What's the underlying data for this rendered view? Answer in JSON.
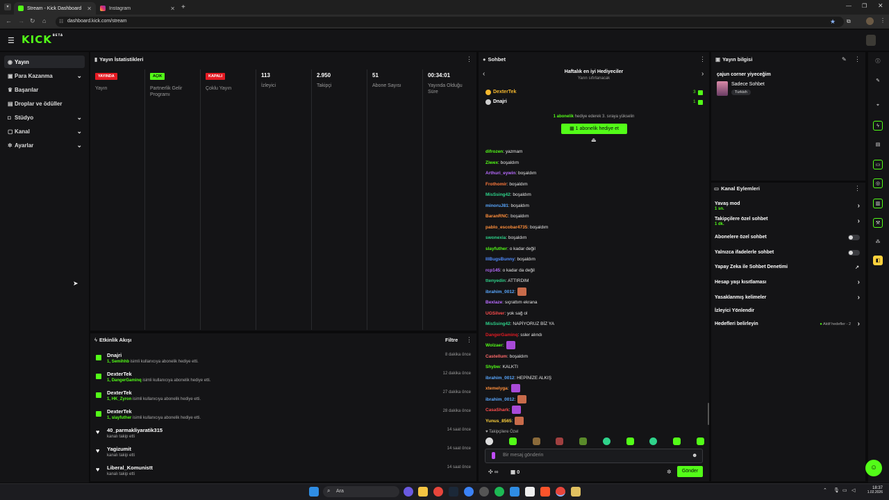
{
  "browser": {
    "tabs": [
      {
        "title": "Stream - Kick Dashboard"
      },
      {
        "title": "Instagram"
      }
    ],
    "url": "dashboard.kick.com/stream"
  },
  "kick": {
    "logo_text": "KICK",
    "logo_sup": "BETA"
  },
  "sidebar": {
    "items": [
      {
        "label": "Yayın",
        "icon": "broadcast-icon"
      },
      {
        "label": "Para Kazanma",
        "icon": "money-icon"
      },
      {
        "label": "Başarılar",
        "icon": "trophy-icon"
      },
      {
        "label": "Droplar ve ödüller",
        "icon": "gift-icon"
      },
      {
        "label": "Stüdyo",
        "icon": "camera-icon"
      },
      {
        "label": "Kanal",
        "icon": "tv-icon"
      },
      {
        "label": "Ayarlar",
        "icon": "gear-icon"
      }
    ]
  },
  "stats": {
    "title": "Yayın İstatistikleri",
    "columns": [
      {
        "value": "YAYINDA",
        "label": "Yayın"
      },
      {
        "value": "AÇIK",
        "label": "Partnerlik Gelir Programı"
      },
      {
        "value": "KAPALI",
        "label": "Çoklu Yayın"
      },
      {
        "value": "113",
        "label": "İzleyici"
      },
      {
        "value": "2.950",
        "label": "Takipçi"
      },
      {
        "value": "51",
        "label": "Abone Sayısı"
      },
      {
        "value": "00:34:01",
        "label": "Yayında Olduğu Süre"
      }
    ]
  },
  "events": {
    "title": "Etkinlik Akışı",
    "filter_label": "Filtre",
    "items": [
      {
        "name": "Dnajri",
        "prefix": "1,",
        "highlight": "Semihhb",
        "desc": "isimli kullanıcıya abonelik hediye etti.",
        "time": "8 dakika önce",
        "type": "gift"
      },
      {
        "name": "DexterTek",
        "prefix": "1,",
        "highlight": "DangerGaminq",
        "desc": "isimli kullanıcıya abonelik hediye etti.",
        "time": "12 dakika önce",
        "type": "gift"
      },
      {
        "name": "DexterTek",
        "prefix": "1,",
        "highlight": "HK_Zyron",
        "desc": "isimli kullanıcıya abonelik hediye etti.",
        "time": "27 dakika önce",
        "type": "gift"
      },
      {
        "name": "DexterTek",
        "prefix": "1,",
        "highlight": "slayfuther",
        "desc": "isimli kullanıcıya abonelik hediye etti.",
        "time": "28 dakika önce",
        "type": "gift"
      },
      {
        "name": "40_parmakliyaratik315",
        "prefix": "",
        "highlight": "",
        "desc": "kanalı takip etti",
        "time": "14 saat önce",
        "type": "follow"
      },
      {
        "name": "Yagizumit",
        "prefix": "",
        "highlight": "",
        "desc": "kanalı takip etti",
        "time": "14 saat önce",
        "type": "follow"
      },
      {
        "name": "Liberal_Komunistt",
        "prefix": "",
        "highlight": "",
        "desc": "kanalı takip etti",
        "time": "14 saat önce",
        "type": "follow"
      }
    ]
  },
  "chat": {
    "title": "Sohbet",
    "leaderboard_title": "Haftalık en iyi Hediyeciler",
    "leaderboard_sub": "Yarın sıfırlanacak",
    "leaders": [
      {
        "name": "DexterTek",
        "count": "3"
      },
      {
        "name": "Dnajri",
        "count": "1"
      }
    ],
    "gift_hint_bold": "1 abonelik",
    "gift_hint": "hediye ederek 3. sıraya yükselin",
    "gift_button": "1 abonelik hediye et",
    "messages": [
      {
        "user": "difrozen",
        "color": "#53fc18",
        "text": ": yazmam"
      },
      {
        "user": "Ziwex",
        "color": "#53fc18",
        "text": ": boşaldım"
      },
      {
        "user": "Arthuri_eywin",
        "color": "#b86bff",
        "text": ": boşaldım"
      },
      {
        "user": "Frothomir",
        "color": "#ff7a3c",
        "text": ": boşaldım"
      },
      {
        "user": "MisSsing42",
        "color": "#2fd38b",
        "text": ": boşaldım"
      },
      {
        "user": "minoruJ81",
        "color": "#5aa8ff",
        "text": ": boşaldım"
      },
      {
        "user": "BaranRNC",
        "color": "#ff8f3c",
        "text": ": boşaldım"
      },
      {
        "user": "pablo_escobar4735",
        "color": "#ff8f3c",
        "text": ": boşaldım"
      },
      {
        "user": "swonexia",
        "color": "#2fd38b",
        "text": ": boşaldım"
      },
      {
        "user": "slayfuther",
        "color": "#53fc18",
        "text": ": o kadar değil"
      },
      {
        "user": "lllBugsBunny",
        "color": "#4f8cff",
        "text": ": boşaldım"
      },
      {
        "user": "rcp145",
        "color": "#b86bff",
        "text": ": o kadar da değil"
      },
      {
        "user": "ttenyedin",
        "color": "#2fd38b",
        "text": ": ATTIRDIM"
      },
      {
        "user": "ibrahim_0012",
        "color": "#5aa8ff",
        "text": ":"
      },
      {
        "user": "Bexlaze",
        "color": "#b86bff",
        "text": ": sıçrattım ekrana"
      },
      {
        "user": "UGSilver",
        "color": "#ff4d4d",
        "text": ": yok sağ ol"
      },
      {
        "user": "MisSsing42",
        "color": "#2fd38b",
        "text": ": NAPİYORUZ BİZ YA"
      },
      {
        "user": "DangerGaminq",
        "color": "#e41b23",
        "text": ": ssler alındı"
      },
      {
        "user": "Wolzaer",
        "color": "#53fc18",
        "text": ":"
      },
      {
        "user": "Castellum",
        "color": "#ff6b6b",
        "text": ": boşaldım"
      },
      {
        "user": "Shybw",
        "color": "#53fc18",
        "text": ": KALKTI"
      },
      {
        "user": "ibrahim_0012",
        "color": "#5aa8ff",
        "text": ": HEPİNİZE ALKIŞ"
      },
      {
        "user": "xtemelyga",
        "color": "#ff8f3c",
        "text": ":"
      },
      {
        "user": "ibrahim_0012",
        "color": "#5aa8ff",
        "text": ":"
      },
      {
        "user": "CasaShark",
        "color": "#ff4d4d",
        "text": ":"
      },
      {
        "user": "Yunus_8565",
        "color": "#ffd23c",
        "text": ":"
      }
    ],
    "followers_only": "Takipçilere Özel",
    "input_placeholder": "Bir mesaj gönderin",
    "send_label": "Gönder",
    "points_value": "∞",
    "gift_count": "0"
  },
  "stream_info": {
    "title": "Yayın bilgisi",
    "stream_title": "çajun corner yiyeceğim",
    "category": "Sadece Sohbet",
    "language": "Turkish"
  },
  "channel_actions": {
    "title": "Kanal Eylemleri",
    "items": [
      {
        "label": "Yavaş mod",
        "sub": "1 sn.",
        "control": "chevron"
      },
      {
        "label": "Takipçilere özel sohbet",
        "sub": "1 dk.",
        "control": "chevron"
      },
      {
        "label": "Abonelere özel sohbet",
        "sub": "",
        "control": "toggle"
      },
      {
        "label": "Yalnızca ifadelerle sohbet",
        "sub": "",
        "control": "toggle"
      },
      {
        "label": "Yapay Zeka ile Sohbet Denetimi",
        "sub": "",
        "control": "external"
      },
      {
        "label": "Hesap yaşı kısıtlaması",
        "sub": "",
        "control": "chevron"
      },
      {
        "label": "Yasaklanmış kelimeler",
        "sub": "",
        "control": "chevron"
      },
      {
        "label": "İzleyici Yönlendir",
        "sub": "",
        "control": "none"
      },
      {
        "label": "Hedefleri belirleyin",
        "sub": "",
        "control": "chevron",
        "status": "Aktif hedefler - 2"
      }
    ]
  },
  "taskbar": {
    "search_label": "Ara",
    "time": "18:37",
    "date": "1.02.2026"
  },
  "colors": {
    "accent": "#53fc18",
    "live": "#e41b23",
    "panel": "#141416",
    "background": "#0b0b0c"
  }
}
